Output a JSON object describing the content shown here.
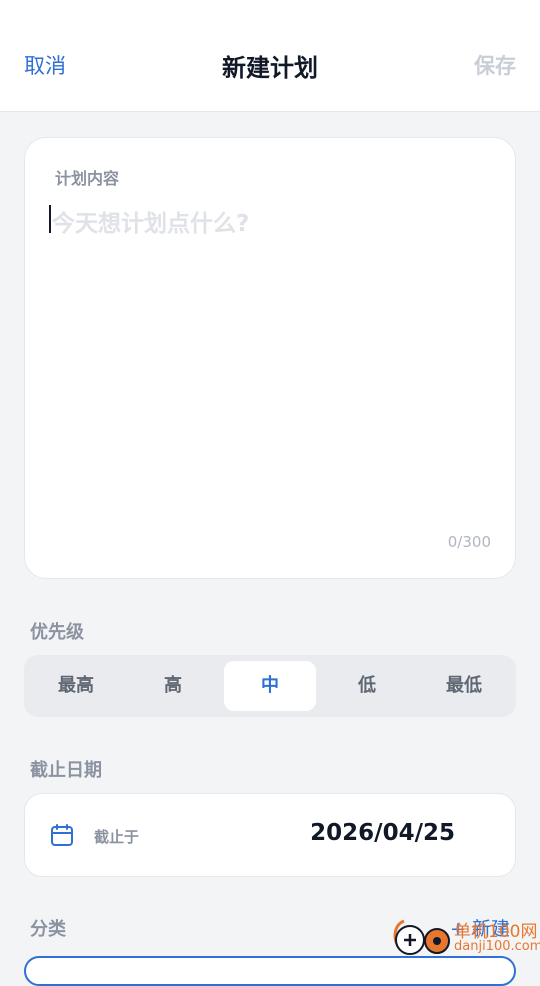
{
  "header": {
    "cancel_label": "取消",
    "title": "新建计划",
    "save_label": "保存"
  },
  "content_card": {
    "label": "计划内容",
    "placeholder": "今天想计划点什么?",
    "counter": "0/300"
  },
  "priority": {
    "label": "优先级",
    "options": [
      "最高",
      "高",
      "中",
      "低",
      "最低"
    ],
    "selected": "中"
  },
  "due_date": {
    "label": "截止日期",
    "field_label": "截止于",
    "value": "2026/04/25",
    "icon": "calendar-icon"
  },
  "category": {
    "label": "分类",
    "new_label": "+ 新建"
  },
  "watermark": {
    "title": "单机100网",
    "subtitle": "danji100.com"
  },
  "colors": {
    "accent": "#2f6fd6",
    "background": "#f3f4f6",
    "disabled": "#c9ced6",
    "muted_label": "#8b93a1"
  }
}
